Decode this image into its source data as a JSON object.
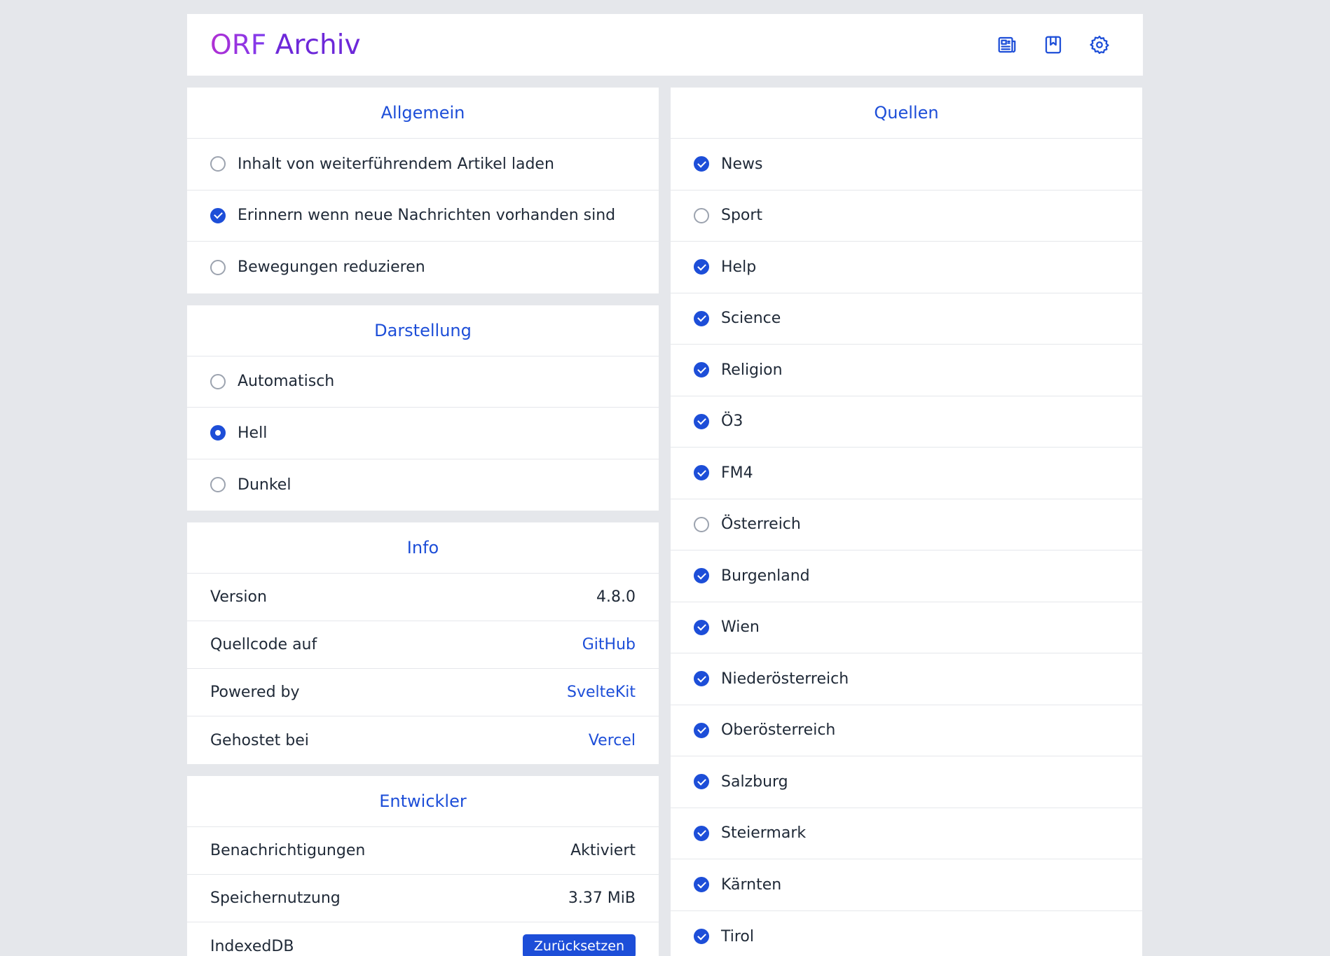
{
  "header": {
    "brand_orf": "ORF",
    "brand_archiv": "Archiv"
  },
  "header_icons": [
    "news-icon",
    "bookmark-icon",
    "settings-icon"
  ],
  "allgemein": {
    "title": "Allgemein",
    "options": [
      {
        "label": "Inhalt von weiterführendem Artikel laden",
        "checked": false
      },
      {
        "label": "Erinnern wenn neue Nachrichten vorhanden sind",
        "checked": true
      },
      {
        "label": "Bewegungen reduzieren",
        "checked": false
      }
    ]
  },
  "darstellung": {
    "title": "Darstellung",
    "options": [
      {
        "label": "Automatisch",
        "selected": false
      },
      {
        "label": "Hell",
        "selected": true
      },
      {
        "label": "Dunkel",
        "selected": false
      }
    ]
  },
  "info": {
    "title": "Info",
    "rows": [
      {
        "key": "Version",
        "value": "4.8.0"
      },
      {
        "key": "Quellcode auf",
        "value": "GitHub"
      },
      {
        "key": "Powered by",
        "value": "SvelteKit"
      },
      {
        "key": "Gehostet bei",
        "value": "Vercel"
      }
    ]
  },
  "entwickler": {
    "title": "Entwickler",
    "rows": [
      {
        "key": "Benachrichtigungen",
        "value": "Aktiviert"
      },
      {
        "key": "Speichernutzung",
        "value": "3.37 MiB"
      },
      {
        "key": "IndexedDB",
        "button": "Zurücksetzen"
      }
    ]
  },
  "quellen": {
    "title": "Quellen",
    "items": [
      {
        "label": "News",
        "checked": true
      },
      {
        "label": "Sport",
        "checked": false
      },
      {
        "label": "Help",
        "checked": true
      },
      {
        "label": "Science",
        "checked": true
      },
      {
        "label": "Religion",
        "checked": true
      },
      {
        "label": "Ö3",
        "checked": true
      },
      {
        "label": "FM4",
        "checked": true
      },
      {
        "label": "Österreich",
        "checked": false
      },
      {
        "label": "Burgenland",
        "checked": true
      },
      {
        "label": "Wien",
        "checked": true
      },
      {
        "label": "Niederösterreich",
        "checked": true
      },
      {
        "label": "Oberösterreich",
        "checked": true
      },
      {
        "label": "Salzburg",
        "checked": true
      },
      {
        "label": "Steiermark",
        "checked": true
      },
      {
        "label": "Kärnten",
        "checked": true
      },
      {
        "label": "Tirol",
        "checked": true
      }
    ]
  },
  "colors": {
    "accent": "#1d4ed8",
    "brand_start": "#b12fd3",
    "brand_end": "#6d28d9",
    "background": "#e5e7eb"
  }
}
